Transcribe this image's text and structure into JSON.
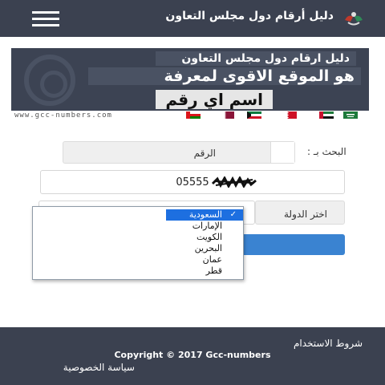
{
  "header": {
    "title": "دليل أرقام دول مجلس التعاون",
    "background": "#3b4150",
    "menu_icon": "hamburger-menu-icon",
    "logo_icon": "hands-logo-icon"
  },
  "banner": {
    "line1": "دليل ارقام دول مجلس التعاون",
    "line2": "هو الموقع الاقوى لمعرفة",
    "line3": "اسم اي رقم",
    "url": "www.gcc-numbers.com",
    "flags": [
      "saudi-arabia-flag",
      "uae-flag",
      "bahrain-flag",
      "kuwait-flag",
      "qatar-flag",
      "oman-flag"
    ]
  },
  "form": {
    "search_by_label": "البحث بـ :",
    "search_by_value": "الرقم",
    "number_value": "05555",
    "country_label": "اختر الدولة",
    "submit_color": "#3a83d1"
  },
  "country_dropdown": {
    "options": [
      "السعودية",
      "الإمارات",
      "الكويت",
      "البحرين",
      "عمان",
      "قطر"
    ],
    "selected": "السعودية",
    "selected_color": "#1d6fe0"
  },
  "footer": {
    "terms": "شروط الاستخدام",
    "copyright": "Copyright © 2017 Gcc-numbers",
    "privacy": "سياسة الخصوصية"
  }
}
